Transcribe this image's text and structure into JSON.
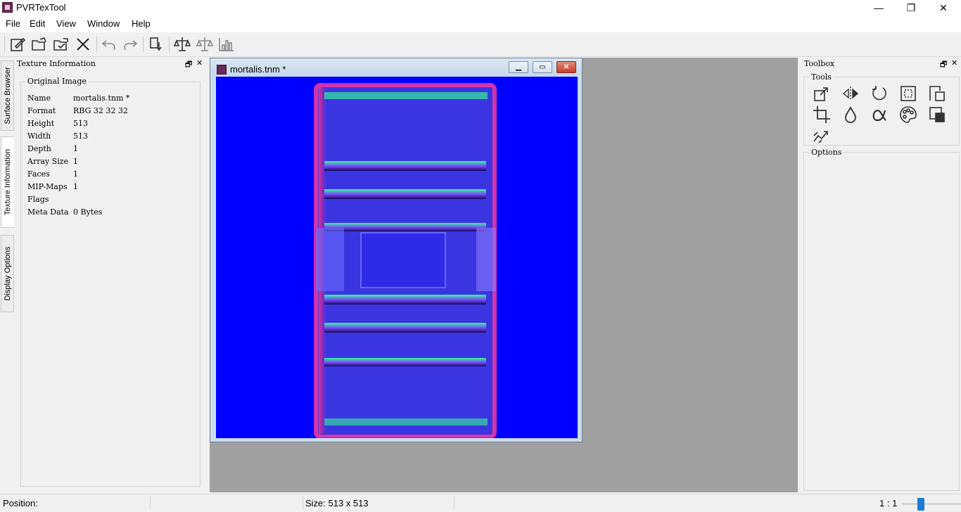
{
  "app": {
    "title": "PVRTexTool",
    "minimize": "—",
    "restore": "❐",
    "close": "✕"
  },
  "menu": {
    "file": "File",
    "edit": "Edit",
    "view": "View",
    "window": "Window",
    "help": "Help"
  },
  "toolbar": {
    "icons": [
      "new-icon",
      "open-icon",
      "save-icon",
      "close-icon",
      "undo-icon",
      "redo-icon",
      "encode-icon",
      "compare-icon",
      "diff-icon",
      "histogram-icon"
    ]
  },
  "side_tabs": {
    "surface_browser": "Surface Browser",
    "texture_information": "Texture Information",
    "display_options": "Display Options"
  },
  "texture_info": {
    "title": "Texture Information",
    "float_glyph": "🗗",
    "close_glyph": "✕",
    "group": "Original Image",
    "rows": [
      {
        "key": "Name",
        "value": "mortalis.tnm *"
      },
      {
        "key": "Format",
        "value": "RBG 32 32 32"
      },
      {
        "key": "Height",
        "value": "513"
      },
      {
        "key": "Width",
        "value": "513"
      },
      {
        "key": "Depth",
        "value": "1"
      },
      {
        "key": "Array Size",
        "value": "1"
      },
      {
        "key": "Faces",
        "value": "1"
      },
      {
        "key": "MIP-Maps",
        "value": "1"
      },
      {
        "key": "Flags",
        "value": ""
      },
      {
        "key": "Meta Data",
        "value": "0 Bytes"
      }
    ]
  },
  "document": {
    "title": "mortalis.tnm *",
    "minimize": "▁",
    "restore": "▭",
    "close": "✕"
  },
  "toolbox": {
    "title": "Toolbox",
    "float_glyph": "🗗",
    "close_glyph": "✕",
    "tools_label": "Tools",
    "options_label": "Options",
    "tools": [
      "resize-icon",
      "flip-icon",
      "rotate-icon",
      "border-icon",
      "pad-icon",
      "crop-icon",
      "color-icon",
      "alpha-icon",
      "palette-icon",
      "premultiply-icon",
      "normal-map-icon"
    ]
  },
  "status": {
    "position": "Position:",
    "size": "Size: 513 x 513",
    "zoom": "1 : 1",
    "zoom_level": 0.3
  }
}
